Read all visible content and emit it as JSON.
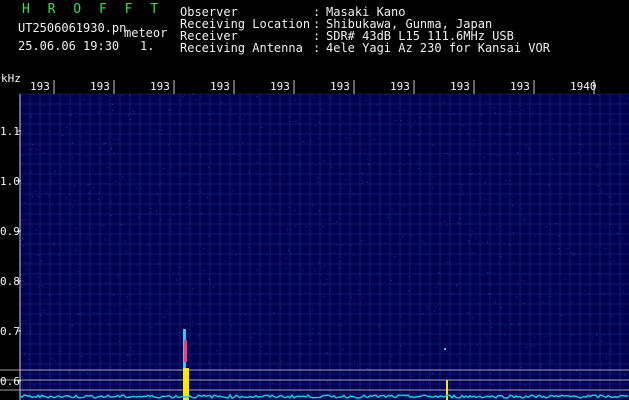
{
  "header": {
    "app_title": "H R O F F T",
    "file_name": "UT2506061930.pn",
    "tag": "meteor",
    "datetime": "25.06.06 19:30",
    "frame": "1.",
    "fields": [
      {
        "label": "Observer",
        "colon": ":",
        "value": "Masaki Kano"
      },
      {
        "label": "Receiving Location",
        "colon": ":",
        "value": "Shibukawa, Gunma, Japan"
      },
      {
        "label": "Receiver",
        "colon": ":",
        "value": "SDR# 43dB L15 111.6MHz USB"
      },
      {
        "label": "Receiving Antenna",
        "colon": ":",
        "value": "4ele Yagi Az 230 for Kansai VOR"
      }
    ]
  },
  "spectrogram": {
    "y_unit": "kHz",
    "y_ticks": [
      "1.1",
      "1.0",
      "0.9",
      "0.8",
      "0.7",
      "0.6"
    ],
    "x_ticks": [
      "193",
      "193",
      "193",
      "193",
      "193",
      "193",
      "193",
      "193",
      "193",
      "1940"
    ],
    "colors": {
      "background": "#000050",
      "grid": "#1a2f8a",
      "ref_lines": "#d8d8d8",
      "baseline": "#00cfe0",
      "meteor_core": "#ff3a6e",
      "meteor_edge": "#30c8ff",
      "meteor_base": "#ffe800"
    }
  }
}
